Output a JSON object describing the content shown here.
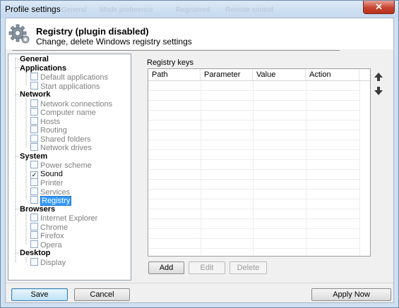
{
  "window": {
    "title": "Profile settings",
    "background_ghost": [
      "General",
      "Mode preference",
      "Registered",
      "Remote control"
    ],
    "close_symbol": "✕"
  },
  "header": {
    "icon": "gear-icon",
    "title": "Registry (plugin disabled)",
    "subtitle": "Change, delete Windows registry settings"
  },
  "tree": [
    {
      "label": "General",
      "type": "group"
    },
    {
      "label": "Applications",
      "type": "group"
    },
    {
      "label": "Default applications",
      "type": "child",
      "checked": false
    },
    {
      "label": "Start applications",
      "type": "child",
      "checked": false
    },
    {
      "label": "Network",
      "type": "group"
    },
    {
      "label": "Network connections",
      "type": "child",
      "checked": false
    },
    {
      "label": "Computer name",
      "type": "child",
      "checked": false
    },
    {
      "label": "Hosts",
      "type": "child",
      "checked": false
    },
    {
      "label": "Routing",
      "type": "child",
      "checked": false
    },
    {
      "label": "Shared folders",
      "type": "child",
      "checked": false
    },
    {
      "label": "Network drives",
      "type": "child",
      "checked": false
    },
    {
      "label": "System",
      "type": "group"
    },
    {
      "label": "Power scheme",
      "type": "child",
      "checked": false
    },
    {
      "label": "Sound",
      "type": "child",
      "checked": true
    },
    {
      "label": "Printer",
      "type": "child",
      "checked": false
    },
    {
      "label": "Services",
      "type": "child",
      "checked": false
    },
    {
      "label": "Registry",
      "type": "child",
      "checked": false,
      "selected": true
    },
    {
      "label": "Browsers",
      "type": "group"
    },
    {
      "label": "Internet Explorer",
      "type": "child",
      "checked": false
    },
    {
      "label": "Chrome",
      "type": "child",
      "checked": false
    },
    {
      "label": "Firefox",
      "type": "child",
      "checked": false
    },
    {
      "label": "Opera",
      "type": "child",
      "checked": false
    },
    {
      "label": "Desktop",
      "type": "group"
    },
    {
      "label": "Display",
      "type": "child",
      "checked": false
    }
  ],
  "registry": {
    "label": "Registry keys",
    "columns": [
      "Path",
      "Parameter",
      "Value",
      "Action"
    ],
    "rows": [],
    "move_up_icon": "arrow-up-icon",
    "move_down_icon": "arrow-down-icon",
    "add_label": "Add",
    "edit_label": "Edit",
    "delete_label": "Delete"
  },
  "footer": {
    "save_label": "Save",
    "cancel_label": "Cancel",
    "apply_label": "Apply Now"
  }
}
